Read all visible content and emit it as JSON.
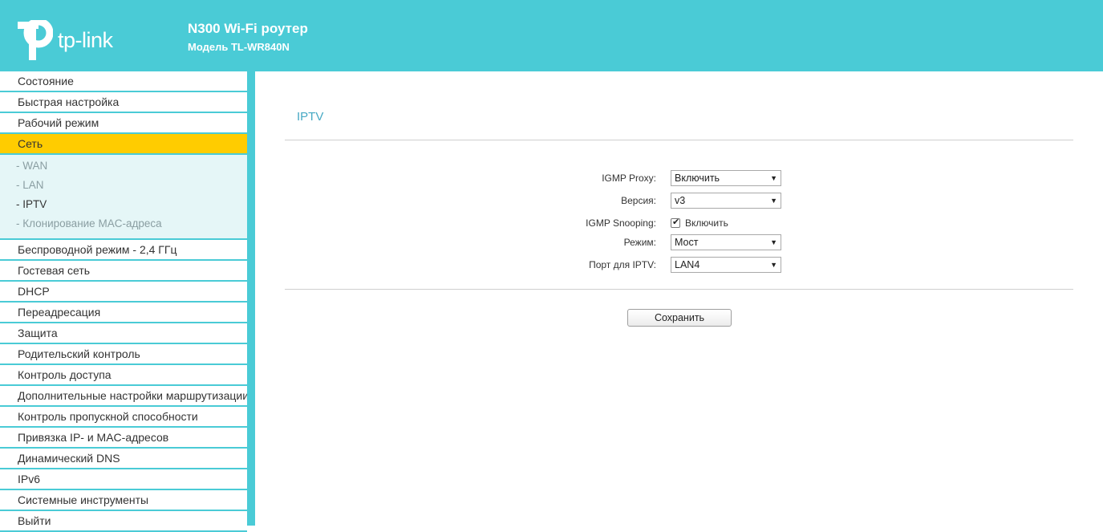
{
  "header": {
    "logo_text": "tp-link",
    "product": "N300 Wi-Fi роутер",
    "model": "Модель TL-WR840N",
    "colors": {
      "background": "#4acbd6",
      "text": "#ffffff"
    }
  },
  "sidebar": {
    "items_top": [
      {
        "label": "Состояние"
      },
      {
        "label": "Быстрая настройка"
      },
      {
        "label": "Рабочий режим"
      }
    ],
    "active": {
      "label": "Сеть"
    },
    "subitems": [
      {
        "label": "- WAN"
      },
      {
        "label": "- LAN"
      },
      {
        "label": "- IPTV"
      },
      {
        "label": "- Клонирование MAC-адреса"
      }
    ],
    "items_bottom": [
      {
        "label": "Беспроводной режим - 2,4 ГГц"
      },
      {
        "label": "Гостевая сеть"
      },
      {
        "label": "DHCP"
      },
      {
        "label": "Переадресация"
      },
      {
        "label": "Защита"
      },
      {
        "label": "Родительский контроль"
      },
      {
        "label": "Контроль доступа"
      },
      {
        "label": "Дополнительные настройки маршрутизации"
      },
      {
        "label": "Контроль пропускной способности"
      },
      {
        "label": "Привязка IP- и MAC-адресов"
      },
      {
        "label": "Динамический DNS"
      },
      {
        "label": "IPv6"
      },
      {
        "label": "Системные инструменты"
      },
      {
        "label": "Выйти"
      }
    ],
    "colors": {
      "active": "#ffcc00",
      "submenu_bg": "#e5f6f7"
    }
  },
  "main": {
    "title": "IPTV",
    "form": {
      "igmp_proxy": {
        "label": "IGMP Proxy:",
        "value": "Включить"
      },
      "version": {
        "label": "Версия:",
        "value": "v3"
      },
      "igmp_snooping": {
        "label": "IGMP Snooping:",
        "checked": true,
        "checkbox_label": "Включить"
      },
      "mode": {
        "label": "Режим:",
        "value": "Мост"
      },
      "iptv_port": {
        "label": "Порт для IPTV:",
        "value": "LAN4"
      }
    },
    "save_label": "Сохранить"
  }
}
